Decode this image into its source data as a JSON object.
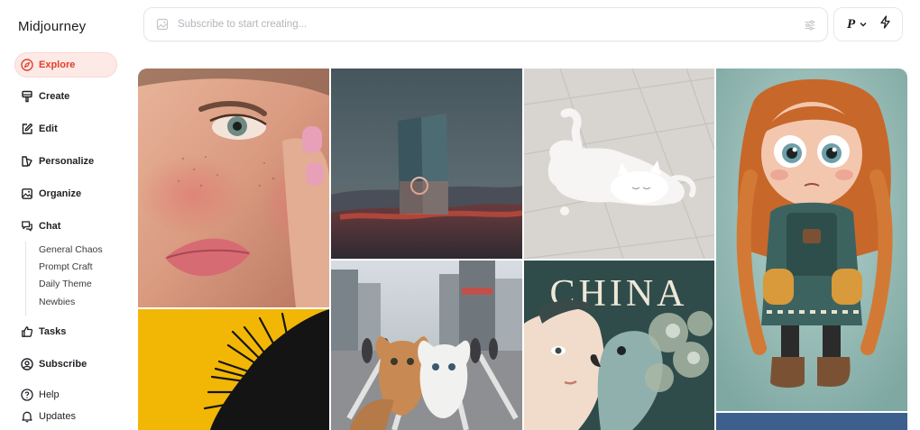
{
  "app": {
    "name": "Midjourney"
  },
  "sidebar": {
    "items": [
      {
        "label": "Explore"
      },
      {
        "label": "Create"
      },
      {
        "label": "Edit"
      },
      {
        "label": "Personalize"
      },
      {
        "label": "Organize"
      },
      {
        "label": "Chat"
      },
      {
        "label": "Tasks"
      },
      {
        "label": "Subscribe"
      },
      {
        "label": "Help"
      },
      {
        "label": "Updates"
      }
    ],
    "chat_rooms": [
      {
        "label": "General Chaos"
      },
      {
        "label": "Prompt Craft"
      },
      {
        "label": "Daily Theme"
      },
      {
        "label": "Newbies"
      }
    ]
  },
  "search": {
    "placeholder": "Subscribe to start creating..."
  },
  "prefs": {
    "personalize_letter": "P"
  },
  "gallery": {
    "poster_title": "CHINA",
    "tiles": [
      {
        "icon": "portrait-woman-freckles"
      },
      {
        "icon": "monolith-sunset-landscape"
      },
      {
        "icon": "melting-cat-figure"
      },
      {
        "icon": "cartoon-girl-braids"
      },
      {
        "icon": "yellow-feather-art"
      },
      {
        "icon": "cats-selfie-city"
      },
      {
        "icon": "china-poster-parrot"
      },
      {
        "icon": "blue-partial-tile"
      }
    ]
  },
  "colors": {
    "accent": "#e0402a",
    "active_bg": "#fde9e6"
  }
}
